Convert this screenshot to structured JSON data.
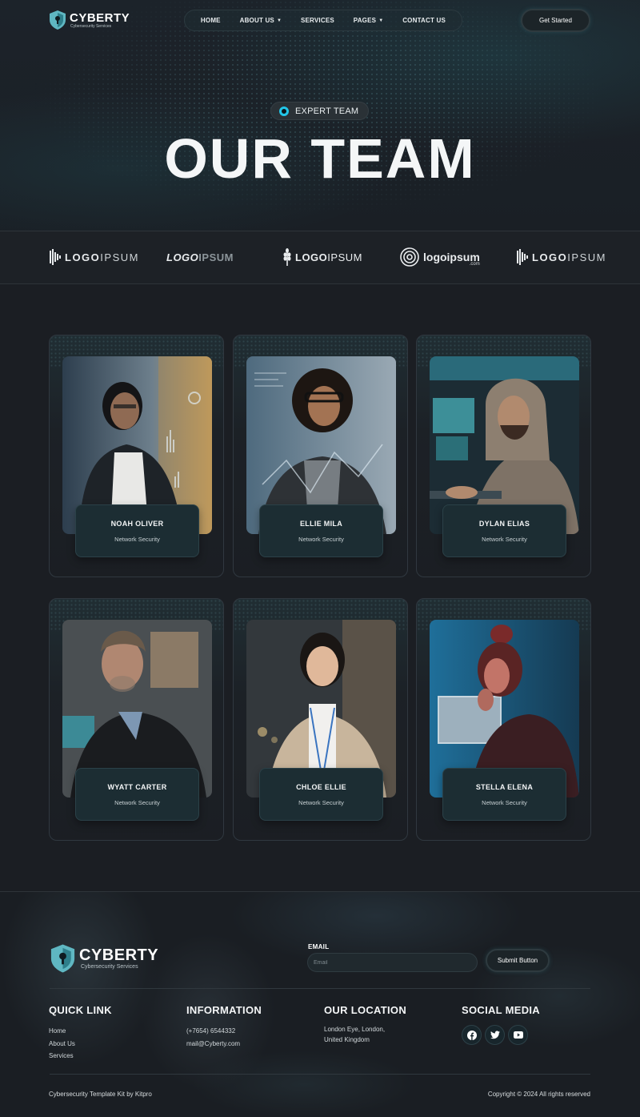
{
  "brand": {
    "name": "CYBERTY",
    "tagline": "Cybersecurity Services",
    "accent_color": "#22c6e8"
  },
  "nav": {
    "items": [
      {
        "label": "HOME",
        "has_dropdown": false
      },
      {
        "label": "ABOUT US",
        "has_dropdown": true
      },
      {
        "label": "SERVICES",
        "has_dropdown": false
      },
      {
        "label": "PAGES",
        "has_dropdown": true
      },
      {
        "label": "CONTACT US",
        "has_dropdown": false
      }
    ],
    "cta_label": "Get Started"
  },
  "hero": {
    "badge": "EXPERT TEAM",
    "title": "OUR TEAM"
  },
  "partner_logos": [
    {
      "icon": "bars-logo-icon",
      "text_bold": "LOGO",
      "text_light": "IPSUM"
    },
    {
      "icon": "",
      "text_bold": "LOGO",
      "text_light": "IPSUM"
    },
    {
      "icon": "wheat-logo-icon",
      "text_bold": "LOGO",
      "text_light": "IPSUM"
    },
    {
      "icon": "spiral-logo-icon",
      "text_bold": "logoipsum",
      "text_light": ".com"
    },
    {
      "icon": "bars-logo-icon",
      "text_bold": "LOGO",
      "text_light": "IPSUM"
    }
  ],
  "team": [
    {
      "name": "NOAH OLIVER",
      "role": "Network Security"
    },
    {
      "name": "ELLIE MILA",
      "role": "Network Security"
    },
    {
      "name": "DYLAN ELIAS",
      "role": "Network Security"
    },
    {
      "name": "WYATT CARTER",
      "role": "Network Security"
    },
    {
      "name": "CHLOE ELLIE",
      "role": "Network Security"
    },
    {
      "name": "STELLA ELENA",
      "role": "Network Security"
    }
  ],
  "footer": {
    "email_label": "EMAIL",
    "email_placeholder": "Email",
    "submit_label": "Submit Button",
    "quick_link": {
      "title": "QUICK LINK",
      "links": [
        "Home",
        "About Us",
        "Services"
      ]
    },
    "information": {
      "title": "INFORMATION",
      "phone": "(+7654) 6544332",
      "email": "mail@Cyberty.com"
    },
    "location": {
      "title": "OUR LOCATION",
      "line1": "London Eye, London,",
      "line2": "United Kingdom"
    },
    "social": {
      "title": "SOCIAL MEDIA",
      "icons": [
        "facebook-icon",
        "twitter-icon",
        "youtube-icon"
      ]
    },
    "credit": "Cybersecurity Template Kit by Kitpro",
    "copyright": "Copyright © 2024 All rights reserved"
  }
}
